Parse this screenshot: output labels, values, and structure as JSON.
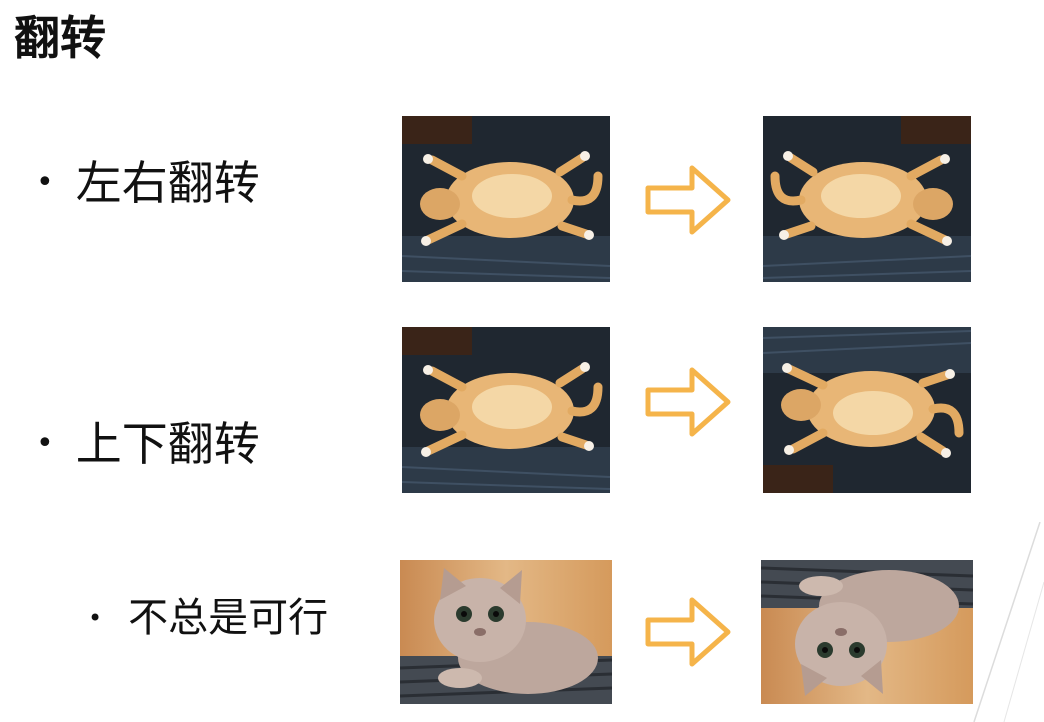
{
  "slide": {
    "title": "翻转"
  },
  "bullets": [
    {
      "text": "左右翻转"
    },
    {
      "text": "上下翻转"
    },
    {
      "text": "不总是可行"
    }
  ],
  "bullet_glyph": "•",
  "colors": {
    "arrow": "#f5b44a",
    "photo_dark_bg": "#1f2730",
    "cat_orange": "#e8b676",
    "kitten_gray": "#bda79d"
  },
  "icons": [
    "right-arrow-icon"
  ]
}
